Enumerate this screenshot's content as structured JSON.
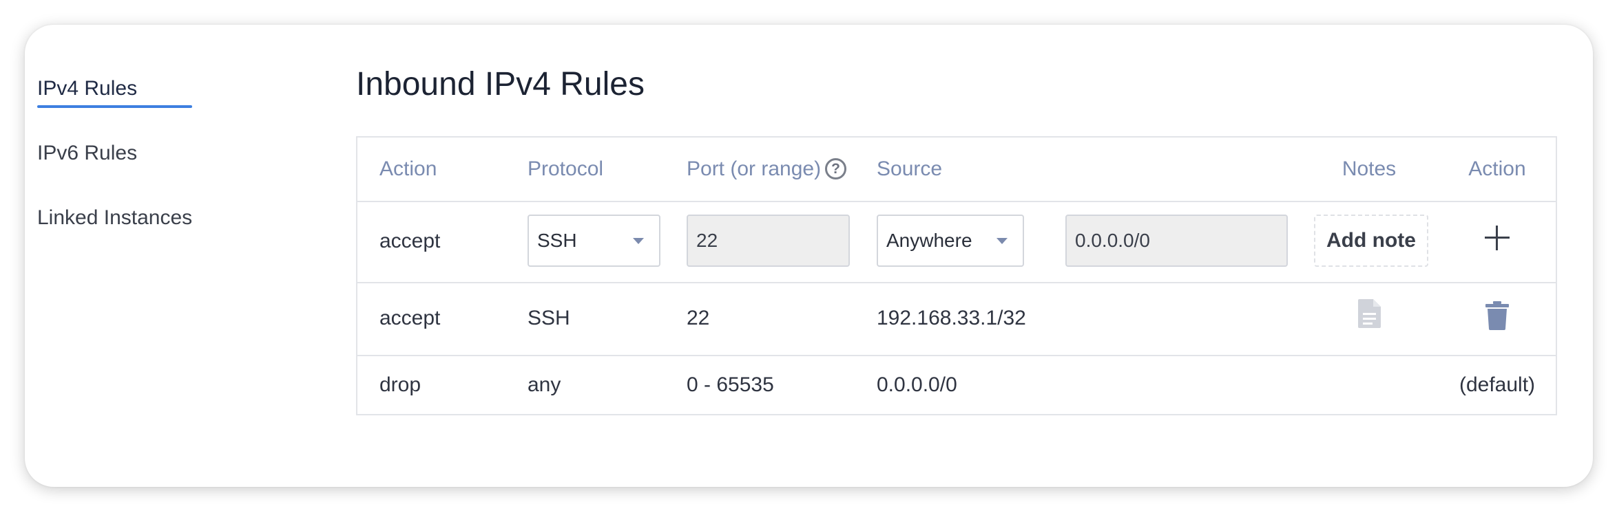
{
  "sidebar": {
    "items": [
      {
        "label": "IPv4 Rules",
        "active": true
      },
      {
        "label": "IPv6 Rules",
        "active": false
      },
      {
        "label": "Linked Instances",
        "active": false
      }
    ]
  },
  "page": {
    "title": "Inbound IPv4 Rules"
  },
  "table": {
    "headers": {
      "action": "Action",
      "protocol": "Protocol",
      "port": "Port (or range)",
      "help": "?",
      "source": "Source",
      "notes": "Notes",
      "action2": "Action"
    },
    "new_rule": {
      "action": "accept",
      "protocol": "SSH",
      "port": "22",
      "source_type": "Anywhere",
      "source_cidr": "0.0.0.0/0",
      "add_note_label": "Add note"
    },
    "rows": [
      {
        "action": "accept",
        "protocol": "SSH",
        "port": "22",
        "source": "192.168.33.1/32",
        "action_label": ""
      },
      {
        "action": "drop",
        "protocol": "any",
        "port": "0 - 65535",
        "source": "0.0.0.0/0",
        "action_label": "(default)"
      }
    ]
  },
  "icons": {
    "help": "question-circle-icon",
    "caret": "caret-down-icon",
    "add": "plus-icon",
    "note": "document-icon",
    "delete": "trash-icon"
  },
  "colors": {
    "accent": "#3d7fe0",
    "header_text": "#7a8bb0",
    "icon_muted": "#d0d3da",
    "trash": "#7a8bb0"
  }
}
